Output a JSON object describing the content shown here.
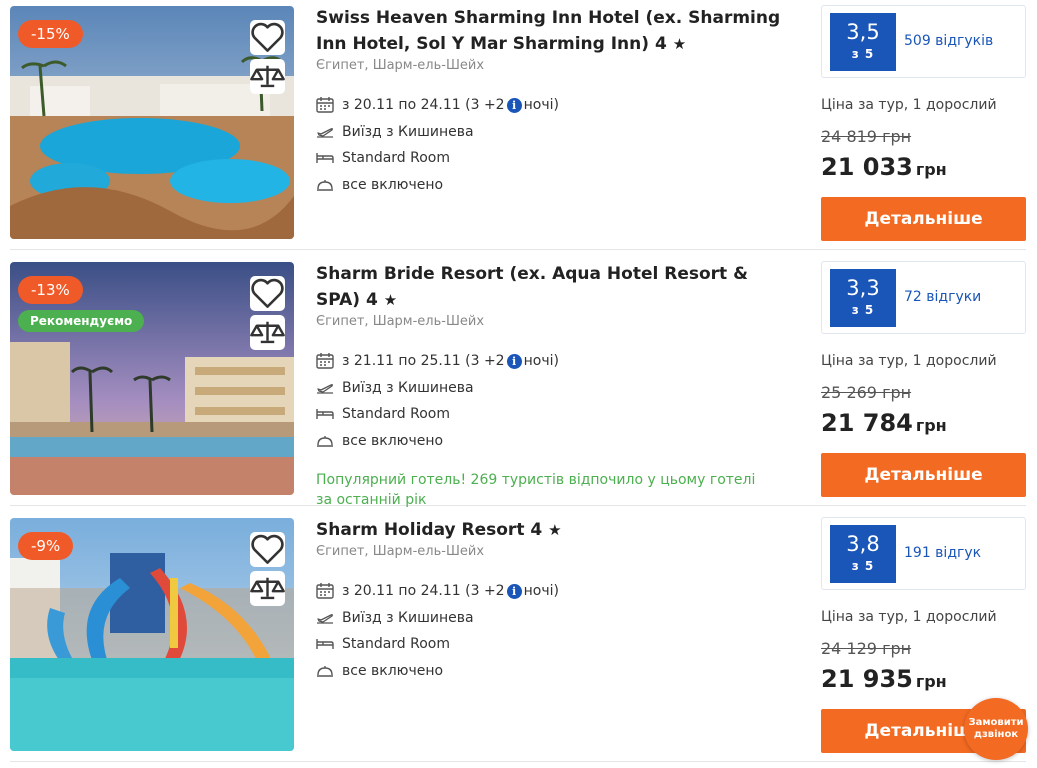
{
  "hotels": [
    {
      "discount": "-15%",
      "recommended": "",
      "name": "Swiss Heaven Sharming Inn Hotel (ex. Sharming Inn Hotel, Sol Y Mar Sharming Inn) 4",
      "location": "Єгипет, Шарм-ель-Шейх",
      "dates_prefix": "з 20.11 по 24.11 (3 +2",
      "dates_suffix": "ночі)",
      "departure": "Виїзд з Кишинева",
      "room": "Standard Room",
      "meal": "все включено",
      "popular": "",
      "rating": "3,5",
      "rating_of": "з 5",
      "reviews": "509 відгуків",
      "price_label": "Ціна за тур, 1 дорослий",
      "old_price": "24 819 грн",
      "new_price": "21 033",
      "currency": "грн",
      "button": "Детальніше"
    },
    {
      "discount": "-13%",
      "recommended": "Рекомендуємо",
      "name": "Sharm Bride Resort (ex. Aqua Hotel Resort & SPA) 4",
      "location": "Єгипет, Шарм-ель-Шейх",
      "dates_prefix": "з 21.11 по 25.11 (3 +2",
      "dates_suffix": "ночі)",
      "departure": "Виїзд з Кишинева",
      "room": "Standard Room",
      "meal": "все включено",
      "popular": "Популярний готель! 269 туристів відпочило у цьому готелі за останній рік",
      "rating": "3,3",
      "rating_of": "з 5",
      "reviews": "72 відгуки",
      "price_label": "Ціна за тур, 1 дорослий",
      "old_price": "25 269 грн",
      "new_price": "21 784",
      "currency": "грн",
      "button": "Детальніше"
    },
    {
      "discount": "-9%",
      "recommended": "",
      "name": "Sharm Holiday Resort 4",
      "location": "Єгипет, Шарм-ель-Шейх",
      "dates_prefix": "з 20.11 по 24.11 (3 +2",
      "dates_suffix": "ночі)",
      "departure": "Виїзд з Кишинева",
      "room": "Standard Room",
      "meal": "все включено",
      "popular": "",
      "rating": "3,8",
      "rating_of": "з 5",
      "reviews": "191 відгук",
      "price_label": "Ціна за тур, 1 дорослий",
      "old_price": "24 129 грн",
      "new_price": "21 935",
      "currency": "грн",
      "button": "Детальніше"
    }
  ],
  "star_icon": "star-icon",
  "info_glyph": "i",
  "callback_label": "Замовити дзвінок",
  "colors": {
    "accent_blue": "#1a56b8",
    "button_orange": "#f36a22",
    "discount_red": "#f05a28",
    "green": "#4caf50"
  }
}
